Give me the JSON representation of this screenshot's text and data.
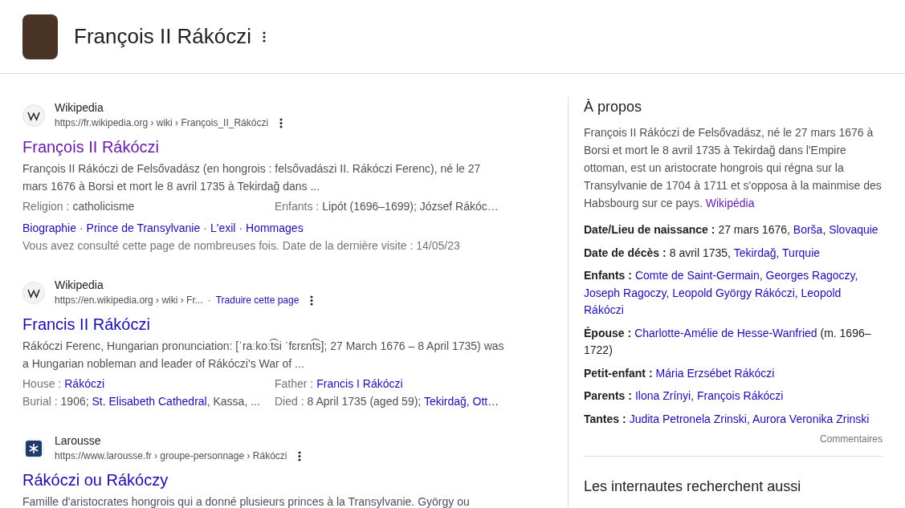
{
  "header": {
    "title": "François II Rákóczi"
  },
  "results": [
    {
      "kind": "wiki",
      "site": "Wikipedia",
      "url": "https://fr.wikipedia.org › wiki › François_II_Rákóczi",
      "title": "François II Rákóczi",
      "visited": true,
      "snippet": "François II Rákóczi de Felsővadász (en hongrois : felsővadászi II. Rákóczi Ferenc), né le 27 mars 1676 à Borsi et mort le 8 avril 1735 à Tekirdağ dans ...",
      "facts": [
        {
          "label": "Religion :",
          "parts": [
            {
              "text": "catholicisme",
              "link": false
            }
          ]
        },
        {
          "label": "Enfants :",
          "parts": [
            {
              "text": "Lipót (1696–1699); József Rákóc…",
              "link": false
            }
          ]
        }
      ],
      "sitelinks": [
        {
          "text": "Biographie"
        },
        {
          "separator": "·",
          "text": "Prince de Transylvanie"
        },
        {
          "separator": "·",
          "text": "L'exil"
        },
        {
          "separator": "·",
          "text": "Hommages"
        }
      ],
      "note": "Vous avez consulté cette page de nombreuses fois. Date de la dernière visite : 14/05/23"
    },
    {
      "kind": "wiki",
      "site": "Wikipedia",
      "url": "https://en.wikipedia.org › wiki › Fr...",
      "url_separator": "·",
      "translate": "Traduire cette page",
      "title": "Francis II Rákóczi",
      "visited": false,
      "snippet": "Rákóczi Ferenc, Hungarian pronunciation: [ˈraːkoːt͡si ˈfɛrɛnt͡s]; 27 March 1676 – 8 April 1735) was a Hungarian nobleman and leader of Rákóczi's War of ...",
      "facts": [
        {
          "label": "House :",
          "parts": [
            {
              "text": "Rákóczi",
              "link": true
            }
          ]
        },
        {
          "label": "Father :",
          "parts": [
            {
              "text": "Francis I Rákóczi",
              "link": true
            }
          ]
        },
        {
          "label": "Burial :",
          "parts": [
            {
              "text": "1906; ",
              "link": false
            },
            {
              "text": "St. Elisabeth Cathedral",
              "link": true
            },
            {
              "text": ", Kassa, ...",
              "link": false
            }
          ]
        },
        {
          "label": "Died :",
          "parts": [
            {
              "text": "8 April 1735 (aged 59); ",
              "link": false
            },
            {
              "text": "Tekirdağ, Ott…",
              "link": true
            }
          ]
        }
      ]
    },
    {
      "kind": "larousse",
      "site": "Larousse",
      "url": "https://www.larousse.fr › groupe-personnage › Rákóczi",
      "title": "Rákóczi ou Rákóczy",
      "visited": false,
      "snippet": "Famille d'aristocrates hongrois qui a donné plusieurs princes à la Transylvanie. György ou"
    }
  ],
  "panel": {
    "heading": "À propos",
    "about": "François II Rákóczi de Felsővadász, né le 27 mars 1676 à Borsi et mort le 8 avril 1735 à Tekirdağ dans l'Empire ottoman, est un aristocrate hongrois qui régna sur la Transylvanie de 1704 à 1711 et s'opposa à la mainmise des Habsbourg sur ce pays.",
    "source": "Wikipédia",
    "facts": [
      {
        "label": "Date/Lieu de naissance :",
        "parts": [
          {
            "text": "27 mars 1676, ",
            "link": false
          },
          {
            "text": "Borša",
            "link": true
          },
          {
            "text": ", ",
            "link": false
          },
          {
            "text": "Slovaquie",
            "link": true
          }
        ]
      },
      {
        "label": "Date de décès :",
        "parts": [
          {
            "text": "8 avril 1735, ",
            "link": false
          },
          {
            "text": "Tekirdağ",
            "link": true
          },
          {
            "text": ", ",
            "link": false
          },
          {
            "text": "Turquie",
            "link": true
          }
        ]
      },
      {
        "label": "Enfants :",
        "parts": [
          {
            "text": "Comte de Saint-Germain, Georges Ragoczy, Joseph Ragoczy, Leopold György Rákóczi, Leopold Rákóczi",
            "link": true
          }
        ]
      },
      {
        "label": "Épouse :",
        "parts": [
          {
            "text": "Charlotte-Amélie de Hesse-Wanfried",
            "link": true
          },
          {
            "text": " (m. 1696–1722)",
            "link": false
          }
        ]
      },
      {
        "label": "Petit-enfant :",
        "parts": [
          {
            "text": "Mária Erzsébet Rákóczi",
            "link": true
          }
        ]
      },
      {
        "label": "Parents :",
        "parts": [
          {
            "text": "Ilona Zrínyi, François Rákóczi",
            "link": true
          }
        ]
      },
      {
        "label": "Tantes :",
        "parts": [
          {
            "text": "Judita Petronela Zrinski, Aurora Veronika Zrinski",
            "link": true
          }
        ]
      }
    ],
    "feedback": "Commentaires",
    "related_heading": "Les internautes recherchent aussi"
  }
}
